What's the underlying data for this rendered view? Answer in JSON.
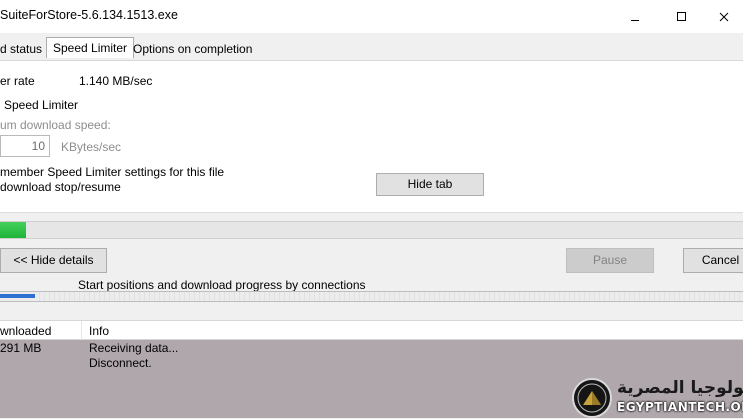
{
  "window": {
    "title": "SuiteForStore-5.6.134.1513.exe"
  },
  "tabs": [
    {
      "label": "d status",
      "active": false
    },
    {
      "label": "Speed Limiter",
      "active": true
    },
    {
      "label": "Options on completion",
      "active": false
    }
  ],
  "speed_limiter": {
    "transfer_rate_label": "er rate",
    "transfer_rate_value": "1.140  MB/sec",
    "use_limiter_label": "Speed Limiter",
    "max_speed_label": "um download speed:",
    "max_speed_value": "10",
    "max_speed_unit": "KBytes/sec",
    "remember_label": "member Speed Limiter settings for this file",
    "stop_resume_label": "download stop/resume",
    "hide_tab_label": "Hide tab"
  },
  "progress": {
    "fraction": 0.035,
    "color": "#22b43c"
  },
  "actions": {
    "hide_details_label": "<< Hide details",
    "pause_label": "Pause",
    "cancel_label": "Cancel"
  },
  "connections": {
    "caption": "Start positions and download progress by connections",
    "fraction": 0.047,
    "color": "#2e6fd0"
  },
  "list": {
    "columns": [
      "wnloaded",
      "Info"
    ],
    "rows": [
      {
        "downloaded": "291  MB",
        "info": "Receiving data..."
      },
      {
        "downloaded": "",
        "info": "Disconnect."
      }
    ]
  },
  "watermark": {
    "arabic_text": "التكنولوجيا المصرية",
    "latin_text": "EGYPTIANTECH.ORG"
  }
}
